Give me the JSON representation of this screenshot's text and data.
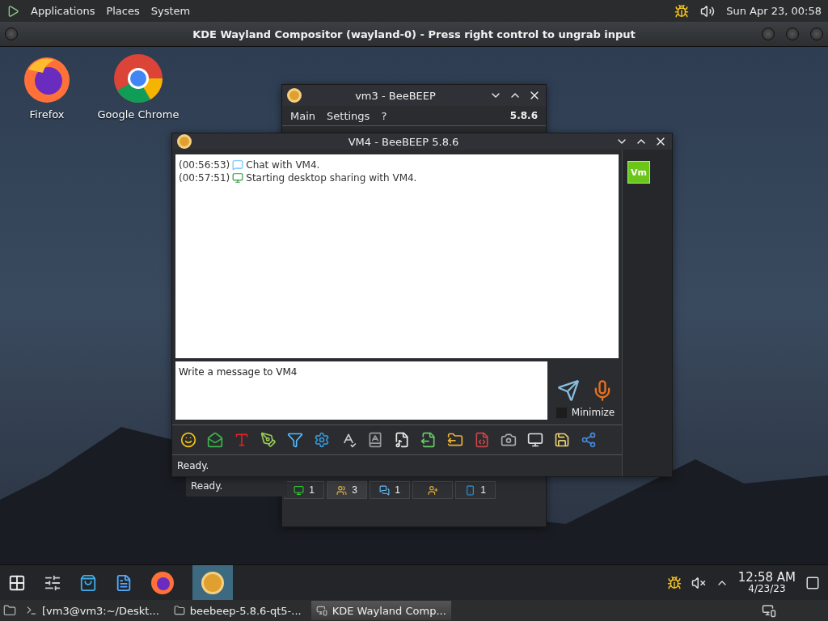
{
  "top_panel": {
    "menus": [
      "Applications",
      "Places",
      "System"
    ],
    "clock": "Sun Apr 23, 00:58"
  },
  "host_window": {
    "title": "KDE Wayland Compositor (wayland-0) - Press right control to ungrab input"
  },
  "desktop_icons": [
    {
      "label": "Firefox",
      "kind": "firefox"
    },
    {
      "label": "Google Chrome",
      "kind": "chrome"
    }
  ],
  "back_window": {
    "title": "vm3 - BeeBEEP",
    "menus": [
      "Main",
      "Settings",
      "?"
    ],
    "version": "5.8.6",
    "status": "Ready.",
    "tabs": [
      {
        "count": "1",
        "selected": false
      },
      {
        "count": "3",
        "selected": true
      },
      {
        "count": "1",
        "selected": false
      },
      {
        "selected": false
      },
      {
        "count": "1",
        "selected": false
      }
    ]
  },
  "chat_window": {
    "title": "VM4 - BeeBEEP 5.8.6",
    "messages": [
      {
        "time": "(00:56:53)",
        "text": "Chat with VM4.",
        "kind": "chat"
      },
      {
        "time": "(00:57:51)",
        "text": "Starting desktop sharing with VM4.",
        "kind": "screen"
      }
    ],
    "input": {
      "placeholder": "Write a message to VM4"
    },
    "minimize": {
      "label": "Minimize",
      "checked": false
    },
    "user_badge": "Vm",
    "status": "Ready."
  },
  "panel": {
    "time": "12:58 AM",
    "date": "4/23/23"
  },
  "taskbar": [
    {
      "label": "[vm3@vm3:~/Deskt...",
      "selected": false
    },
    {
      "label": "beebeep-5.8.6-qt5-...",
      "selected": false
    },
    {
      "label": "KDE Wayland Comp...",
      "selected": true
    }
  ]
}
